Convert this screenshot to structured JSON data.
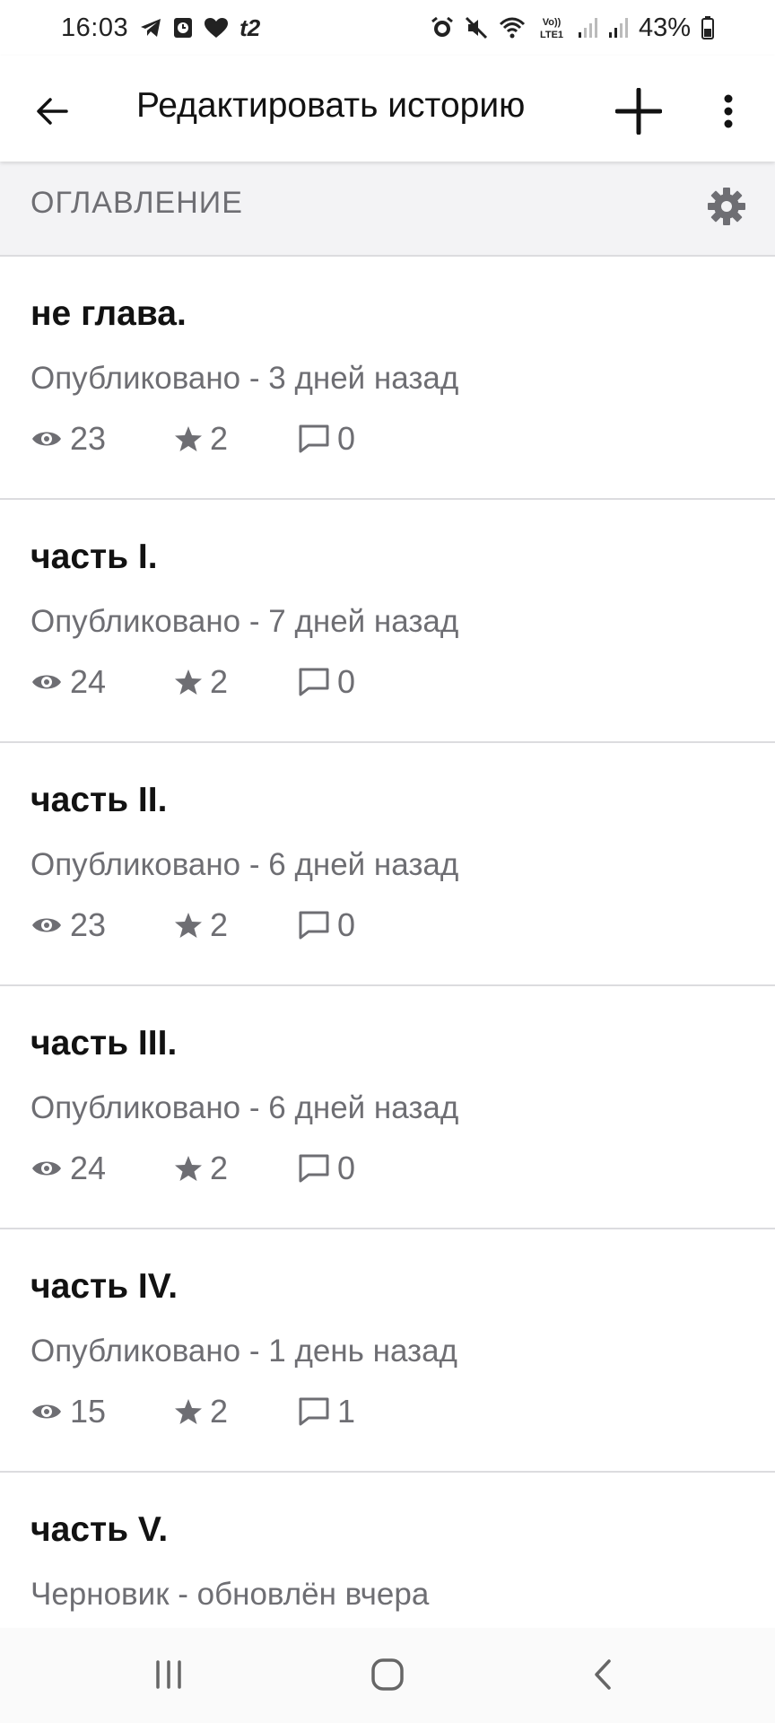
{
  "status_bar": {
    "time": "16:03",
    "carrier": "t2",
    "battery": "43%",
    "signal_badge_top": "Vo))",
    "signal_badge_bottom": "LTE1"
  },
  "app_bar": {
    "title": "Редактировать историю",
    "icons": {
      "back": "arrow-left-icon",
      "add": "plus-icon",
      "more": "more-vertical-icon"
    }
  },
  "toc": {
    "title": "ОГЛАВЛЕНИЕ",
    "settings_icon": "gear-icon"
  },
  "chapters": [
    {
      "title": "не глава.",
      "status": "Опубликовано - 3 дней назад",
      "views": "23",
      "votes": "2",
      "comments": "0"
    },
    {
      "title": "часть I.",
      "status": "Опубликовано - 7 дней назад",
      "views": "24",
      "votes": "2",
      "comments": "0"
    },
    {
      "title": "часть II.",
      "status": "Опубликовано - 6 дней назад",
      "views": "23",
      "votes": "2",
      "comments": "0"
    },
    {
      "title": "часть III.",
      "status": "Опубликовано - 6 дней назад",
      "views": "24",
      "votes": "2",
      "comments": "0"
    },
    {
      "title": "часть IV.",
      "status": "Опубликовано - 1 день назад",
      "views": "15",
      "votes": "2",
      "comments": "1"
    },
    {
      "title": "часть V.",
      "status": "Черновик - обновлён вчера"
    }
  ],
  "colors": {
    "text_primary": "#121212",
    "text_secondary": "#6e6e73",
    "header_bg": "#f3f3f5",
    "divider": "#dcdcdf"
  }
}
